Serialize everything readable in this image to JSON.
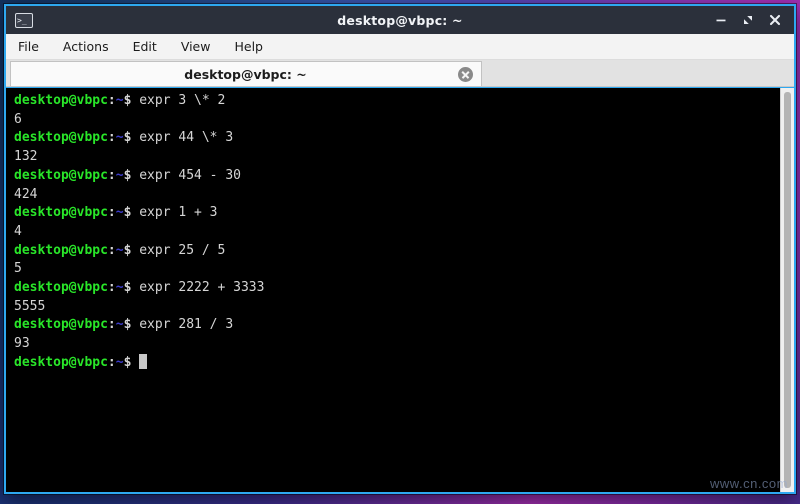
{
  "window": {
    "title": "desktop@vbpc: ~",
    "app_icon": "terminal-icon",
    "buttons": {
      "minimize": "minimize-icon",
      "maximize": "maximize-icon",
      "close": "close-icon"
    }
  },
  "menubar": {
    "items": [
      {
        "label": "File"
      },
      {
        "label": "Actions"
      },
      {
        "label": "Edit"
      },
      {
        "label": "View"
      },
      {
        "label": "Help"
      }
    ]
  },
  "tabbar": {
    "tab": {
      "label": "desktop@vbpc: ~",
      "close_icon": "close-circle-icon"
    }
  },
  "terminal": {
    "prompt": {
      "user_host": "desktop@vbpc",
      "colon": ":",
      "path": "~",
      "symbol": "$"
    },
    "colors": {
      "background": "#000000",
      "foreground": "#d6d6d6",
      "prompt_user": "#29e629",
      "prompt_path": "#3b3bc9",
      "cursor": "#c8c8c8"
    },
    "lines": [
      {
        "type": "command",
        "text": " expr 3 \\* 2"
      },
      {
        "type": "output",
        "text": "6"
      },
      {
        "type": "command",
        "text": " expr 44 \\* 3"
      },
      {
        "type": "output",
        "text": "132"
      },
      {
        "type": "command",
        "text": " expr 454 - 30"
      },
      {
        "type": "output",
        "text": "424"
      },
      {
        "type": "command",
        "text": " expr 1 + 3"
      },
      {
        "type": "output",
        "text": "4"
      },
      {
        "type": "command",
        "text": " expr 25 / 5"
      },
      {
        "type": "output",
        "text": "5"
      },
      {
        "type": "command",
        "text": " expr 2222 + 3333"
      },
      {
        "type": "output",
        "text": "5555"
      },
      {
        "type": "command",
        "text": " expr 281 / 3"
      },
      {
        "type": "output",
        "text": "93"
      },
      {
        "type": "cursor",
        "text": " "
      }
    ]
  },
  "scrollbar": {
    "orientation": "vertical",
    "thumb_position": "full"
  },
  "watermark": {
    "text": "www.cn.com"
  }
}
